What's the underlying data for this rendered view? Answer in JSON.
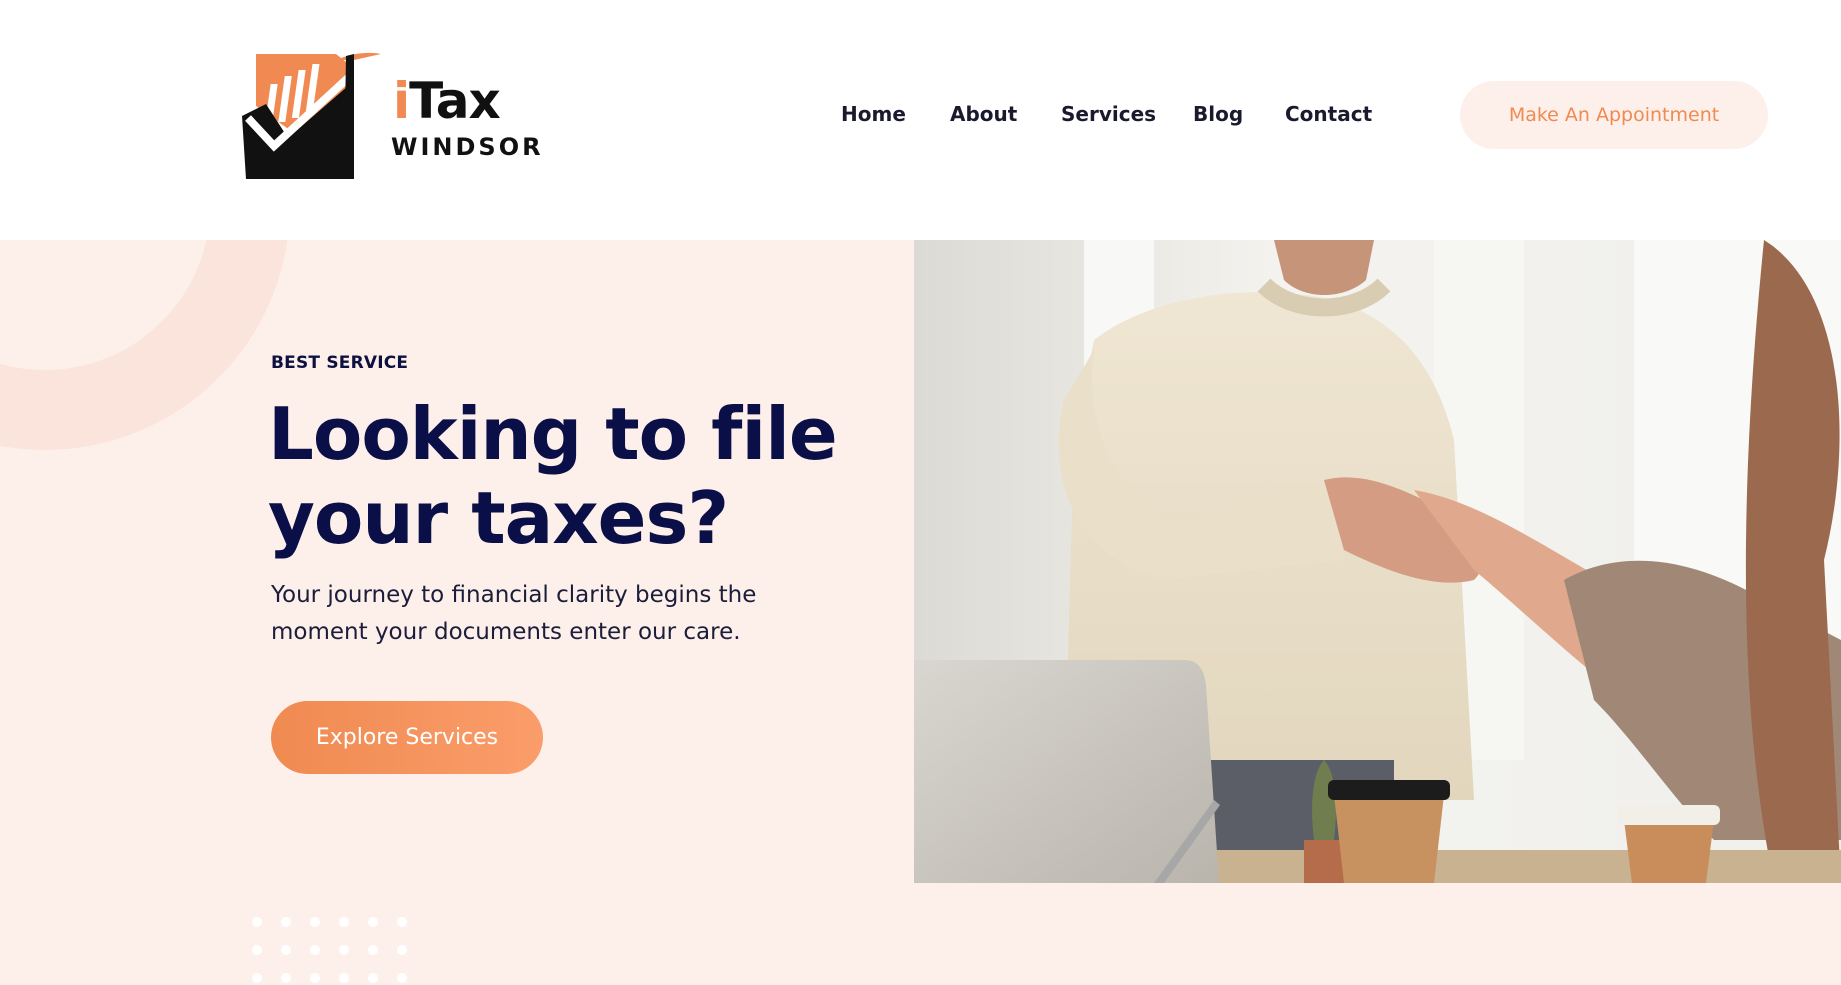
{
  "brand": {
    "logo_main_i": "i",
    "logo_main_rest": "Tax",
    "logo_sub": "WINDSOR",
    "accent_color": "#f08a52",
    "dark_color": "#111111"
  },
  "nav": {
    "items": [
      {
        "label": "Home"
      },
      {
        "label": "About"
      },
      {
        "label": "Services"
      },
      {
        "label": "Blog"
      },
      {
        "label": "Contact"
      }
    ],
    "cta_label": "Make An Appointment"
  },
  "hero": {
    "eyebrow": "BEST SERVICE",
    "headline": "Looking to file your taxes?",
    "subtext": "Your journey to financial clarity begins the moment your documents enter our care.",
    "button_label": "Explore Services",
    "background_color": "#fdf0eb",
    "headline_color": "#0b0f47"
  },
  "photo": {
    "description_icon": "handshake-photo"
  }
}
